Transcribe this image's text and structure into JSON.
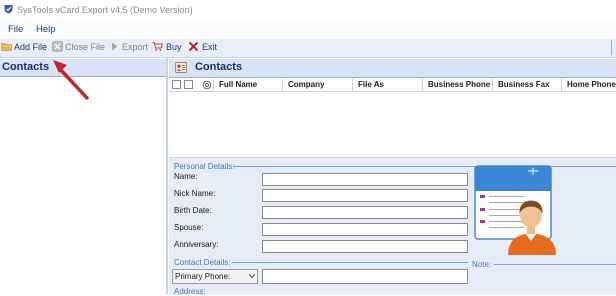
{
  "window": {
    "title": "SysTools vCard Export v4.5 (Demo Version)"
  },
  "menu": {
    "items": [
      "File",
      "Help"
    ]
  },
  "toolbar": {
    "add_file": "Add File",
    "close_file": "Close File",
    "export": "Export",
    "buy": "Buy",
    "exit": "Exit"
  },
  "left_panel": {
    "title": "Contacts"
  },
  "right_panel": {
    "title": "Contacts"
  },
  "grid": {
    "columns": [
      "Full Name",
      "Company",
      "File As",
      "Business Phone",
      "Business Fax",
      "Home Phone"
    ]
  },
  "personal": {
    "section": "Personal Details:",
    "fields": [
      "Name:",
      "Nick Name:",
      "Birth Date:",
      "Spouse:",
      "Anniversary:"
    ]
  },
  "contact": {
    "section": "Contact Details:",
    "phone_type": "Primary Phone:",
    "note_label": "Note:",
    "address_label": "Address:"
  },
  "colors": {
    "accent": "#1a3366",
    "panel_header": "#d8e4f5",
    "details_bg": "#e6edf7",
    "arrow": "#c0282e"
  },
  "icons": [
    "app-icon",
    "add-file-icon",
    "close-file-icon",
    "export-icon",
    "buy-icon",
    "exit-icon",
    "contacts-icon",
    "vcard-illustration"
  ]
}
